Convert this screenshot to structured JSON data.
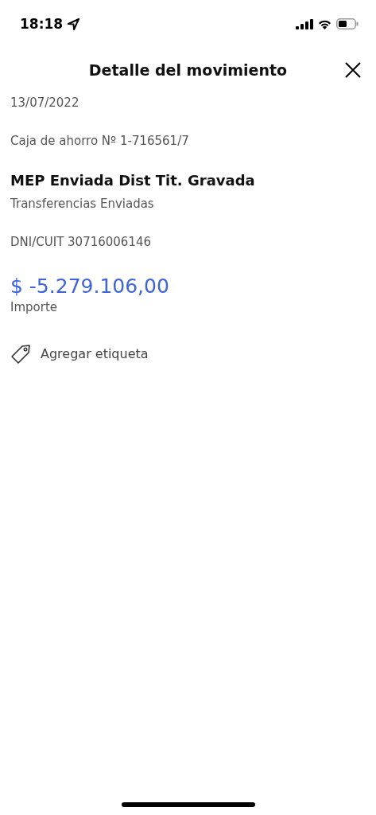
{
  "status_bar": {
    "time": "18:18"
  },
  "header": {
    "title": "Detalle del movimiento"
  },
  "details": {
    "date": "13/07/2022",
    "account": "Caja de ahorro Nº 1-716561/7",
    "concept": "MEP Enviada Dist Tit. Gravada",
    "category": "Transferencias Enviadas",
    "tax_id": "DNI/CUIT 30716006146",
    "amount": "$ -5.279.106,00",
    "amount_label": "Importe"
  },
  "tag_action": {
    "label": "Agregar etiqueta"
  }
}
